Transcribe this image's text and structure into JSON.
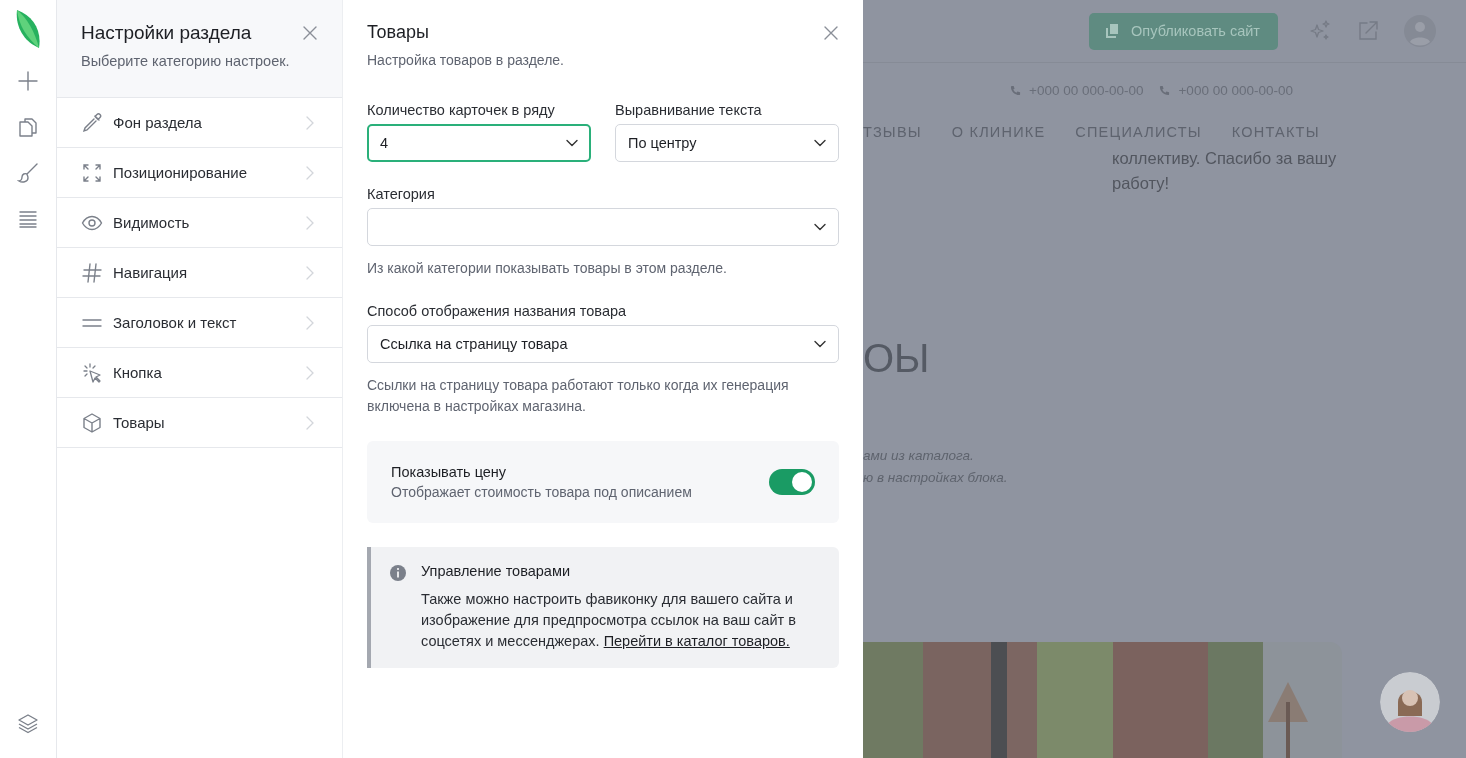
{
  "settings_panel": {
    "title": "Настройки раздела",
    "subtitle": "Выберите категорию настроек.",
    "items": [
      {
        "label": "Фон раздела"
      },
      {
        "label": "Позиционирование"
      },
      {
        "label": "Видимость"
      },
      {
        "label": "Навигация"
      },
      {
        "label": "Заголовок и текст"
      },
      {
        "label": "Кнопка"
      },
      {
        "label": "Товары"
      }
    ]
  },
  "products_panel": {
    "title": "Товары",
    "subtitle": "Настройка товаров в разделе.",
    "selects": [
      {
        "kind": "half",
        "label": "Количество карточек в ряду",
        "value": "4",
        "focused": true
      },
      {
        "kind": "half",
        "label": "Выравнивание текста",
        "value": "По центру",
        "focused": false
      },
      {
        "kind": "full",
        "label": "Категория",
        "hint": "Из какой категории показывать товары в этом разделе.",
        "focused": false
      },
      {
        "kind": "full",
        "label": "Способ отображения названия товара",
        "value": "Ссылка на страницу товара",
        "hint": "Ссылки на страницу товара работают только когда их генерация включена в настройках магазина.",
        "focused": false
      }
    ],
    "toggle": {
      "label": "Показывать цену",
      "description": "Отображает стоимость товара под описанием",
      "on": true
    },
    "info": {
      "title": "Управление товарами",
      "text": "Также можно настроить фавиконку для вашего сайта и изображение для предпросмотра ссылок на ваш сайт в соцсетях и мессенджерах.",
      "link": "Перейти в каталог товаров."
    }
  },
  "background": {
    "publish_button": "Опубликовать сайт",
    "phones": [
      "+000 00 000-00-00",
      "+000 00 000-00-00"
    ],
    "nav": [
      "ТЗЫВЫ",
      "О КЛИНИКЕ",
      "СПЕЦИАЛИСТЫ",
      "КОНТАКТЫ"
    ],
    "review_lines": [
      "коллективу. Спасибо за вашу",
      "работу!"
    ],
    "heading": "ОЫ",
    "caption_lines": [
      "ами из каталога.",
      "ю в настройках блока."
    ]
  }
}
